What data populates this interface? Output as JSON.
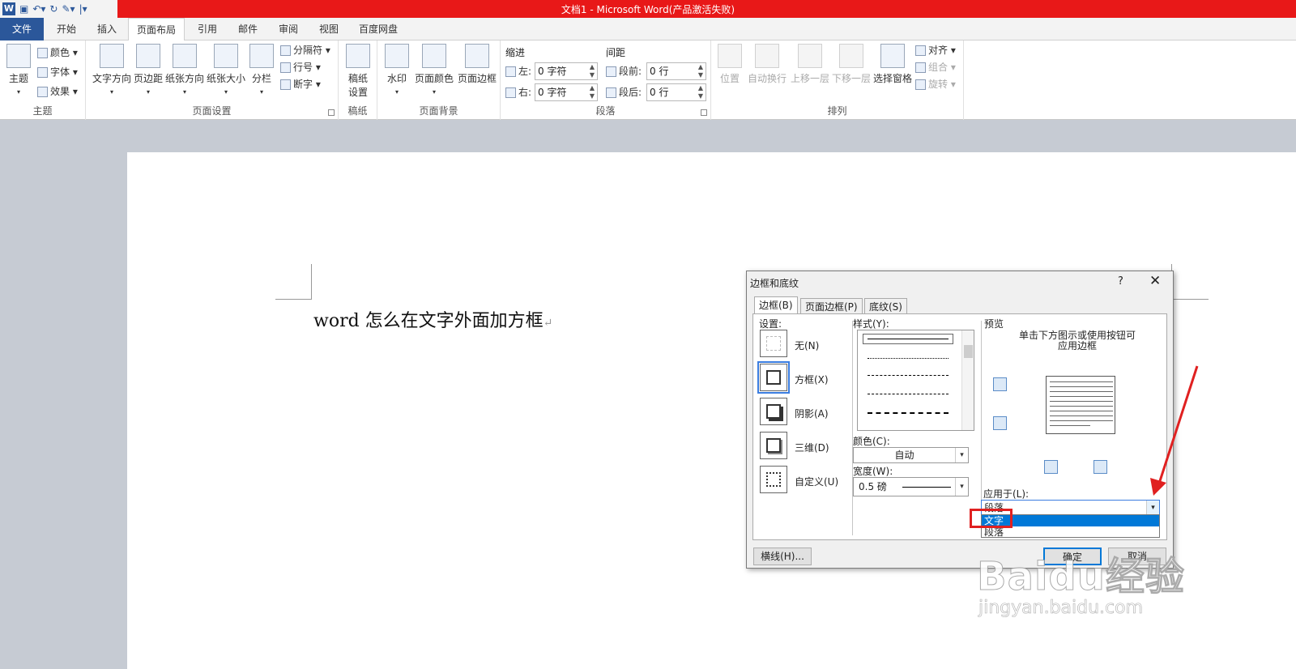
{
  "window": {
    "title": "文档1 - Microsoft Word(产品激活失败)"
  },
  "tabs": [
    "文件",
    "开始",
    "插入",
    "页面布局",
    "引用",
    "邮件",
    "审阅",
    "视图",
    "百度网盘"
  ],
  "ribbon": {
    "theme": {
      "main": "主题",
      "colors": "颜色",
      "font": "字体",
      "effects": "效果",
      "group": "主题"
    },
    "page_setup": {
      "text_dir": "文字方向",
      "margins": "页边距",
      "orientation": "纸张方向",
      "size": "纸张大小",
      "columns": "分栏",
      "breaks": "分隔符",
      "line_numbers": "行号",
      "hyphenation": "断字",
      "group": "页面设置"
    },
    "manuscript": {
      "btn_line1": "稿纸",
      "btn_line2": "设置",
      "group": "稿纸"
    },
    "background": {
      "watermark": "水印",
      "page_color": "页面颜色",
      "page_borders": "页面边框",
      "group": "页面背景"
    },
    "paragraph": {
      "indent": "缩进",
      "left": "左:",
      "right": "右:",
      "left_val": "0 字符",
      "right_val": "0 字符",
      "spacing": "间距",
      "before": "段前:",
      "after": "段后:",
      "before_val": "0 行",
      "after_val": "0 行",
      "group": "段落"
    },
    "arrange": {
      "position": "位置",
      "wrap": "自动换行",
      "forward": "上移一层",
      "backward": "下移一层",
      "pane": "选择窗格",
      "align": "对齐",
      "group_btn": "组合",
      "rotate": "旋转",
      "group": "排列"
    }
  },
  "document": {
    "text": "word 怎么在文字外面加方框",
    "para_mark": "↵"
  },
  "dialog": {
    "title": "边框和底纹",
    "help": "?",
    "close": "✕",
    "tabs": [
      "边框(B)",
      "页面边框(P)",
      "底纹(S)"
    ],
    "settings_label": "设置:",
    "settings": [
      "无(N)",
      "方框(X)",
      "阴影(A)",
      "三维(D)",
      "自定义(U)"
    ],
    "style_label": "样式(Y):",
    "color_label": "颜色(C):",
    "color_value": "自动",
    "width_label": "宽度(W):",
    "width_value": "0.5 磅",
    "preview_label": "预览",
    "preview_hint_1": "单击下方图示或使用按钮可",
    "preview_hint_2": "应用边框",
    "apply_label": "应用于(L):",
    "apply_value": "段落",
    "apply_options": [
      "文字",
      "段落"
    ],
    "hline_button": "横线(H)...",
    "ok": "确定",
    "cancel": "取消"
  },
  "watermark": {
    "brand": "Baidu经验",
    "url": "jingyan.baidu.com"
  }
}
